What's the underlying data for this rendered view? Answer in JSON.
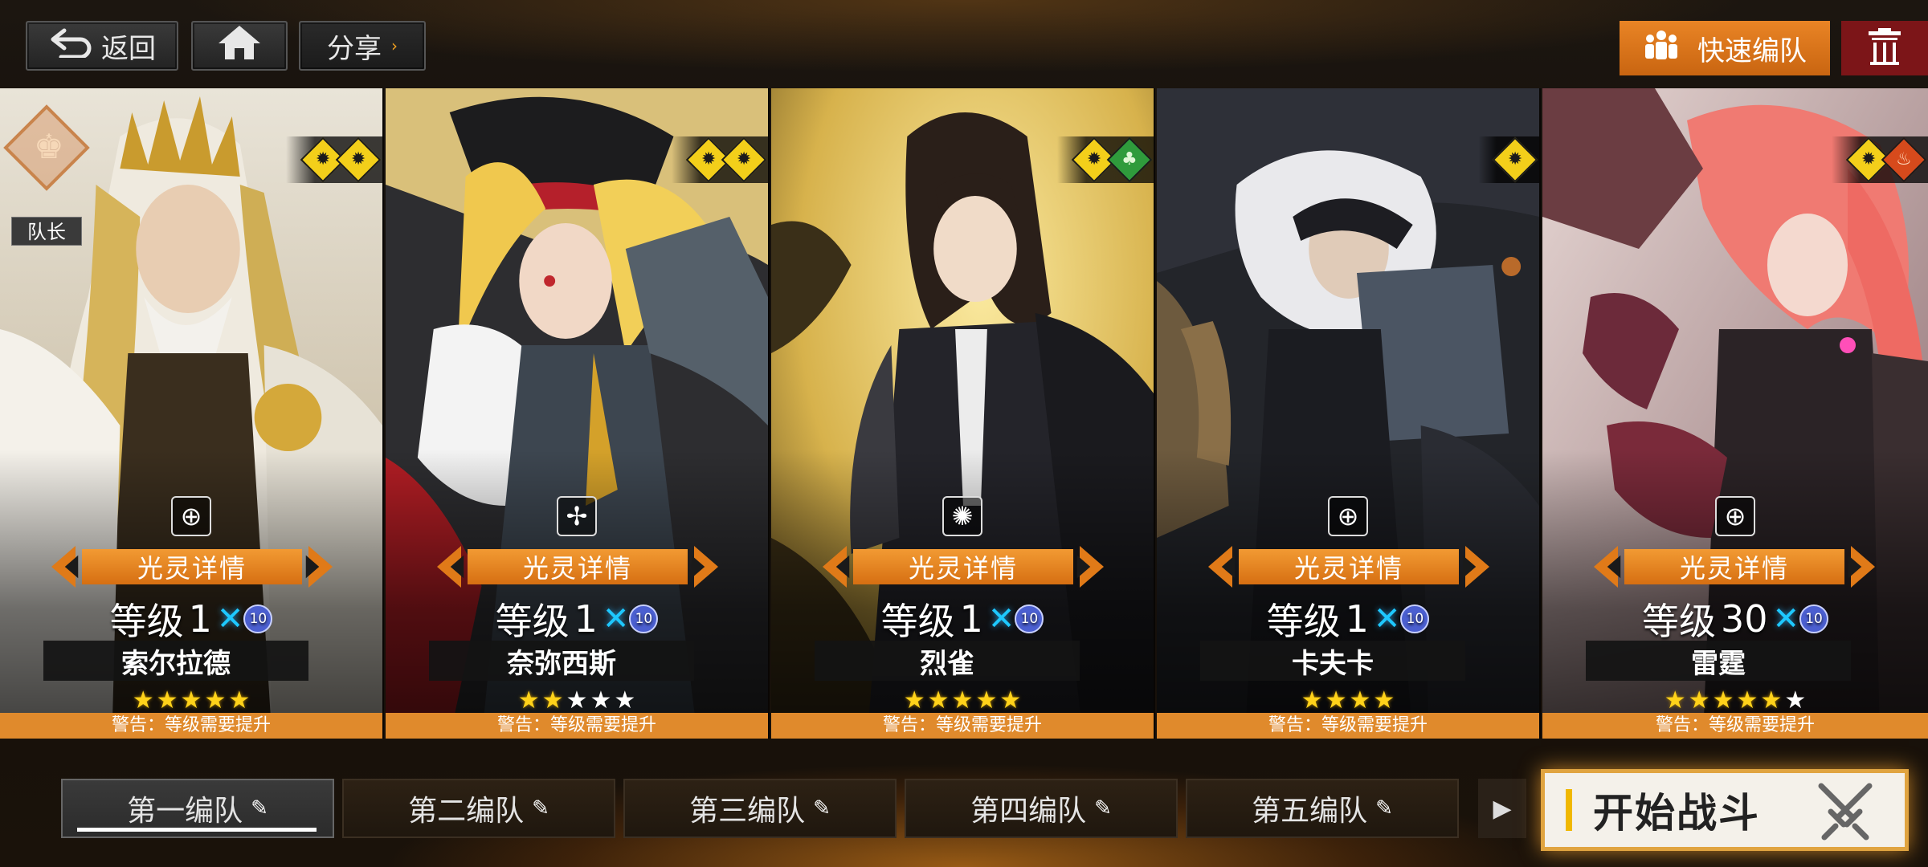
{
  "top_bar": {
    "back_label": "返回",
    "share_label": "分享",
    "quick_team_label": "快速编队"
  },
  "colors": {
    "accent_orange": "#e07a18",
    "delete_red": "#7c1518",
    "warn_orange": "#e08a2c",
    "star_gold": "#ffd21a"
  },
  "cards": [
    {
      "name": "索尔拉德",
      "level_prefix": "等级",
      "level": "1",
      "rank_badge": "10",
      "detail_label": "光灵详情",
      "warning": "警告：等级需要提升",
      "leader_tag": "队长",
      "class_icon": "crosshair-icon",
      "elements": [
        "dark",
        "dark"
      ],
      "stars_filled": 5,
      "stars_total": 5
    },
    {
      "name": "奈弥西斯",
      "level_prefix": "等级",
      "level": "1",
      "rank_badge": "10",
      "detail_label": "光灵详情",
      "warning": "警告：等级需要提升",
      "class_icon": "pinwheel-icon",
      "elements": [
        "dark",
        "dark"
      ],
      "stars_filled": 2,
      "stars_total": 5
    },
    {
      "name": "烈雀",
      "level_prefix": "等级",
      "level": "1",
      "rank_badge": "10",
      "detail_label": "光灵详情",
      "warning": "警告：等级需要提升",
      "class_icon": "burst-icon",
      "elements": [
        "dark",
        "nature"
      ],
      "stars_filled": 5,
      "stars_total": 5
    },
    {
      "name": "卡夫卡",
      "level_prefix": "等级",
      "level": "1",
      "rank_badge": "10",
      "detail_label": "光灵详情",
      "warning": "警告：等级需要提升",
      "class_icon": "crosshair-icon",
      "elements": [
        "dark"
      ],
      "stars_filled": 4,
      "stars_total": 4
    },
    {
      "name": "雷霆",
      "level_prefix": "等级",
      "level": "30",
      "rank_badge": "10",
      "detail_label": "光灵详情",
      "warning": "警告：等级需要提升",
      "class_icon": "crosshair-icon",
      "elements": [
        "dark",
        "fire"
      ],
      "stars_filled": 5,
      "stars_total": 6
    }
  ],
  "teams": [
    {
      "label": "第一编队",
      "active": true
    },
    {
      "label": "第二编队",
      "active": false
    },
    {
      "label": "第三编队",
      "active": false
    },
    {
      "label": "第四编队",
      "active": false
    },
    {
      "label": "第五编队",
      "active": false
    }
  ],
  "start_button": {
    "label": "开始战斗"
  }
}
